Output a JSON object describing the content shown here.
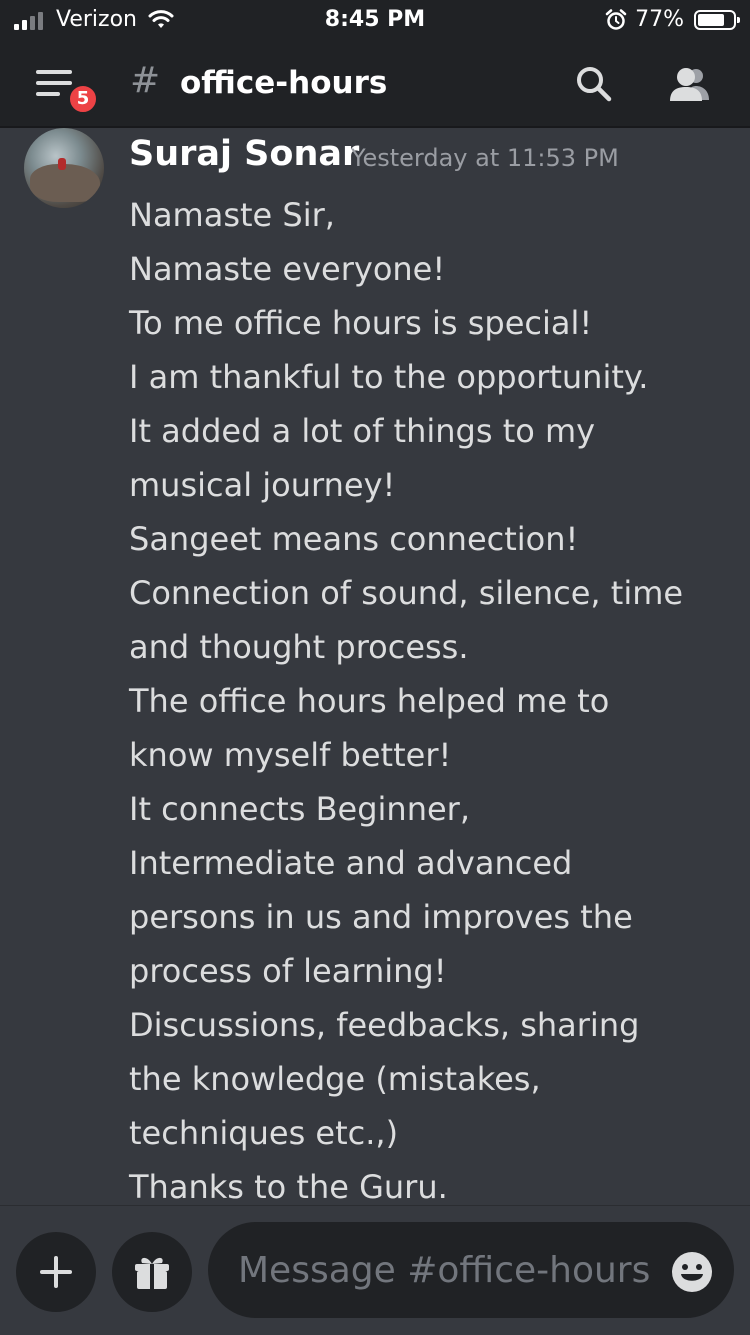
{
  "status_bar": {
    "carrier": "Verizon",
    "time": "8:45 PM",
    "battery": "77%",
    "battery_level": 0.77
  },
  "header": {
    "hash_symbol": "#",
    "channel_name": "office-hours",
    "notification_count": "5",
    "icons": [
      "menu-icon",
      "search-icon",
      "members-icon"
    ]
  },
  "message": {
    "author": "Suraj Sonar",
    "timestamp": "Yesterday at 11:53 PM",
    "lines": [
      "Namaste Sir,",
      "Namaste everyone!",
      "To me office hours is special!",
      "I am thankful to the opportunity.",
      "It added a lot of things to my",
      "musical journey!",
      "Sangeet means connection!",
      "Connection of sound, silence, time",
      "and thought process.",
      "The office hours helped me to",
      "know myself better!",
      "It connects Beginner,",
      "Intermediate and advanced",
      "persons in us and improves the",
      "process of learning!",
      "Discussions, feedbacks, sharing",
      "the knowledge (mistakes,",
      "techniques etc.,)",
      "Thanks to the Guru."
    ]
  },
  "composer": {
    "placeholder": "Message #office-hours",
    "value": "",
    "icons": [
      "plus-icon",
      "gift-icon",
      "emoji-icon"
    ]
  },
  "colors": {
    "background": "#36393f",
    "header": "#202225",
    "badge": "#ed4245",
    "text": "#dcddde",
    "muted": "#9a9da3"
  }
}
